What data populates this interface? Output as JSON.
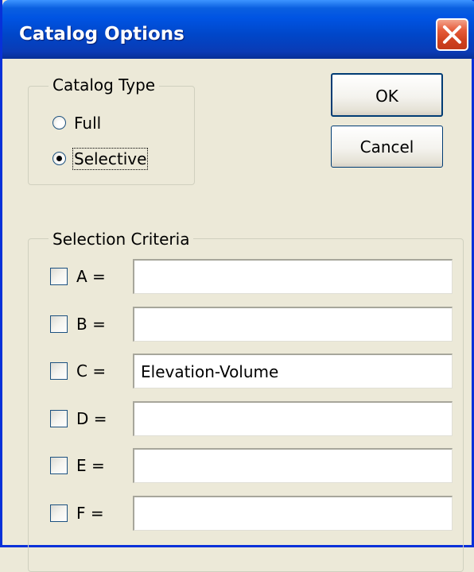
{
  "window": {
    "title": "Catalog Options"
  },
  "catalog_type": {
    "legend": "Catalog Type",
    "options": [
      {
        "label": "Full",
        "selected": false
      },
      {
        "label": "Selective",
        "selected": true
      }
    ]
  },
  "buttons": {
    "ok": "OK",
    "cancel": "Cancel"
  },
  "selection_criteria": {
    "legend": "Selection Criteria",
    "rows": [
      {
        "label": "A =",
        "checked": false,
        "value": ""
      },
      {
        "label": "B =",
        "checked": false,
        "value": ""
      },
      {
        "label": "C =",
        "checked": false,
        "value": "Elevation-Volume"
      },
      {
        "label": "D =",
        "checked": false,
        "value": ""
      },
      {
        "label": "E =",
        "checked": false,
        "value": ""
      },
      {
        "label": "F =",
        "checked": false,
        "value": ""
      }
    ]
  },
  "icons": {
    "close": "close-icon",
    "radio_selected": "radio-dot"
  },
  "colors": {
    "titlebar": "#0054e3",
    "face": "#ece9d8",
    "close_button": "#e65c3a"
  }
}
